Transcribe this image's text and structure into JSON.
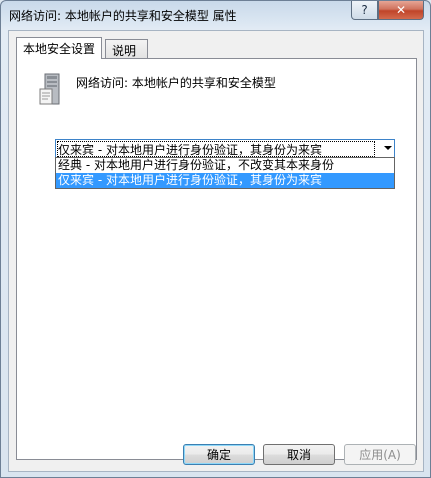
{
  "window": {
    "title": "网络访问: 本地帐户的共享和安全模型 属性",
    "help_glyph": "?",
    "close_glyph": "✕"
  },
  "tabs": [
    {
      "label": "本地安全设置",
      "active": true
    },
    {
      "label": "说明",
      "active": false
    }
  ],
  "policy": {
    "icon": "server-policy-icon",
    "name": "网络访问: 本地帐户的共享和安全模型"
  },
  "select": {
    "value": "仅来宾 - 对本地用户进行身份验证，其身份为来宾",
    "options": [
      {
        "label": "经典 - 对本地用户进行身份验证，不改变其本来身份",
        "selected": false
      },
      {
        "label": "仅来宾 - 对本地用户进行身份验证，其身份为来宾",
        "selected": true
      }
    ]
  },
  "buttons": {
    "ok": "确定",
    "cancel": "取消",
    "apply": "应用(A)"
  },
  "colors": {
    "highlight": "#3399ff",
    "close": "#c04429"
  }
}
